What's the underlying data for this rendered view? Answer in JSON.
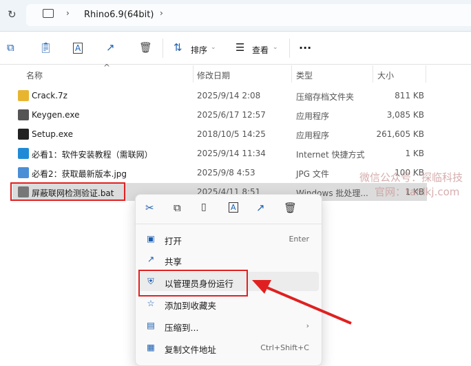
{
  "address": {
    "breadcrumb": "Rhino6.9(64bit)"
  },
  "toolbar": {
    "sort": "排序",
    "view": "查看",
    "more": "···"
  },
  "columns": {
    "name": "名称",
    "date": "修改日期",
    "type": "类型",
    "size": "大小"
  },
  "files": [
    {
      "name": "Crack.7z",
      "date": "2025/9/14 2:08",
      "type": "压缩存档文件夹",
      "size": "811 KB",
      "icon": "zip-folder-icon",
      "color": "#e8b530"
    },
    {
      "name": "Keygen.exe",
      "date": "2025/6/17 12:57",
      "type": "应用程序",
      "size": "3,085 KB",
      "icon": "exe-icon",
      "color": "#555"
    },
    {
      "name": "Setup.exe",
      "date": "2018/10/5 14:25",
      "type": "应用程序",
      "size": "261,605 KB",
      "icon": "rhino-setup-icon",
      "color": "#222"
    },
    {
      "name": "必看1：软件安装教程（需联网）",
      "date": "2025/9/14 11:34",
      "type": "Internet 快捷方式",
      "size": "1 KB",
      "icon": "edge-shortcut-icon",
      "color": "#1f8bd6"
    },
    {
      "name": "必看2：获取最新版本.jpg",
      "date": "2025/9/8 4:53",
      "type": "JPG 文件",
      "size": "100 KB",
      "icon": "image-icon",
      "color": "#4a8fd6"
    },
    {
      "name": "屏蔽联网检测验证.bat",
      "date": "2025/4/11 8:51",
      "type": "Windows 批处理...",
      "size": "1 KB",
      "icon": "batch-file-icon",
      "color": "#777"
    }
  ],
  "menu": {
    "items": [
      {
        "label": "打开",
        "shortcut": "Enter",
        "icon": "open-icon"
      },
      {
        "label": "共享",
        "shortcut": "",
        "icon": "share-icon"
      },
      {
        "label": "以管理员身份运行",
        "shortcut": "",
        "icon": "shield-icon"
      },
      {
        "label": "添加到收藏夹",
        "shortcut": "",
        "icon": "star-icon"
      },
      {
        "label": "压缩到...",
        "shortcut": "›",
        "icon": "zip-icon"
      },
      {
        "label": "复制文件地址",
        "shortcut": "Ctrl+Shift+C",
        "icon": "copy-path-icon"
      }
    ]
  },
  "watermark": {
    "line1": "微信公众号：探临科技",
    "line2": "官网：tanlkj.com"
  },
  "colors": {
    "accent": "#1c5fb0",
    "highlight": "#e02020"
  }
}
